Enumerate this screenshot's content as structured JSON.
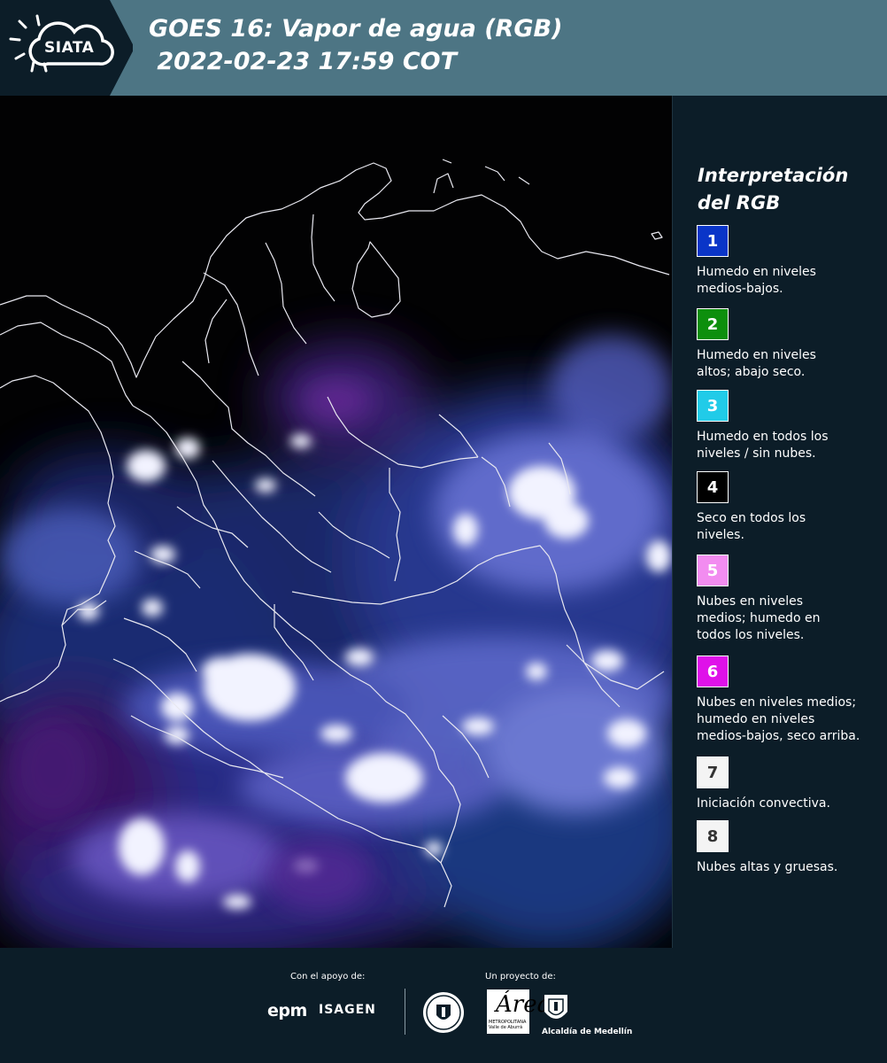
{
  "header": {
    "logo_text": "SIATA",
    "title_line1": "GOES 16: Vapor de agua (RGB)",
    "title_line2": " 2022-02-23 17:59 COT",
    "background": "#4d7584"
  },
  "legend": {
    "title_line1": "Interpretación",
    "title_line2": "del RGB",
    "items": [
      {
        "number": "1",
        "color": "#0a35c8",
        "text_color": "#ffffff",
        "lines": [
          "Humedo en niveles",
          "medios-bajos."
        ]
      },
      {
        "number": "2",
        "color": "#0d8f0d",
        "text_color": "#ffffff",
        "lines": [
          "Humedo en niveles",
          "altos; abajo seco."
        ]
      },
      {
        "number": "3",
        "color": "#21cbe8",
        "text_color": "#ffffff",
        "lines": [
          "Humedo en todos los",
          "niveles / sin nubes."
        ]
      },
      {
        "number": "4",
        "color": "#000000",
        "text_color": "#ffffff",
        "lines": [
          "Seco en todos los",
          "niveles."
        ]
      },
      {
        "number": "5",
        "color": "#f28cf0",
        "text_color": "#ffffff",
        "lines": [
          "Nubes en niveles",
          "medios; humedo en",
          "todos los niveles."
        ]
      },
      {
        "number": "6",
        "color": "#df11e9",
        "text_color": "#ffffff",
        "lines": [
          "Nubes en niveles medios;",
          "humedo en niveles",
          "medios-bajos, seco arriba."
        ]
      },
      {
        "number": "7",
        "color": "#f4f4f4",
        "text_color": "#333333",
        "lines": [
          "Iniciación convectiva."
        ]
      },
      {
        "number": "8",
        "color": "#f4f4f4",
        "text_color": "#333333",
        "lines": [
          "Nubes altas y gruesas."
        ]
      }
    ]
  },
  "footer": {
    "support_label": "Con el apoyo de:",
    "project_label": "Un proyecto de:",
    "sponsor_1": "epm",
    "sponsor_2": "ISAGEN",
    "partner_alcaldia": "Alcaldía de Medellín",
    "area_letter": "Área",
    "area_caption": "METROPOLITANA Valle de Aburrá"
  }
}
